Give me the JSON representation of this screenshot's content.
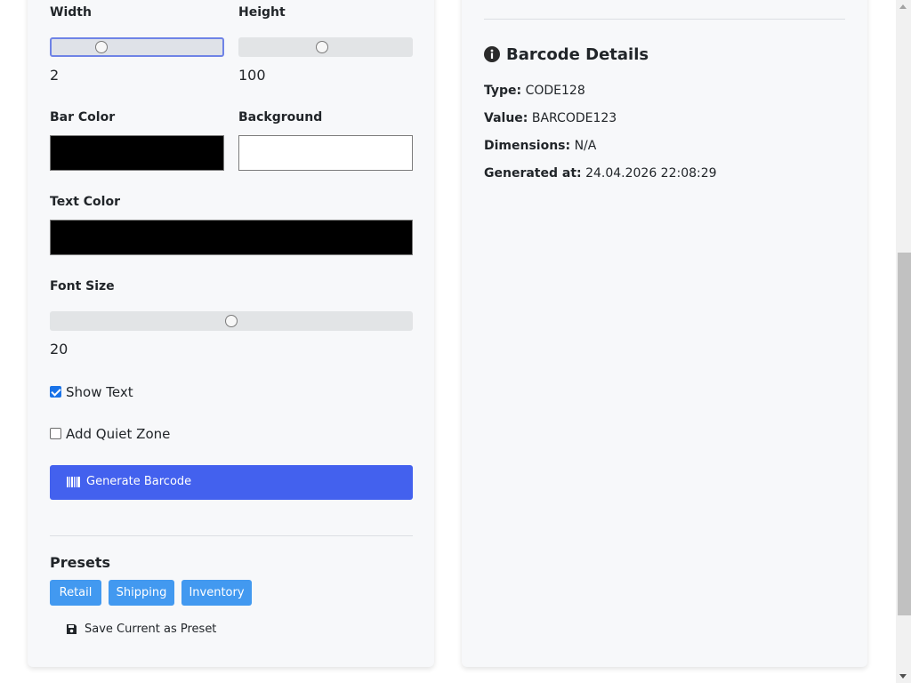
{
  "settings": {
    "width": {
      "label": "Width",
      "value": "2",
      "slider_fraction": 0.29
    },
    "height": {
      "label": "Height",
      "value": "100",
      "slider_fraction": 0.48
    },
    "bar_color": {
      "label": "Bar Color",
      "color": "#000000"
    },
    "background": {
      "label": "Background",
      "color": "#ffffff"
    },
    "text_color": {
      "label": "Text Color",
      "color": "#000000"
    },
    "font_size": {
      "label": "Font Size",
      "value": "20",
      "slider_fraction": 0.5
    },
    "show_text": {
      "label": "Show Text",
      "checked": true
    },
    "quiet_zone": {
      "label": "Add Quiet Zone",
      "checked": false
    },
    "generate_label": "Generate Barcode"
  },
  "presets": {
    "title": "Presets",
    "buttons": [
      "Retail",
      "Shipping",
      "Inventory"
    ],
    "save_label": "Save Current as Preset"
  },
  "details": {
    "title": "Barcode Details",
    "type_label": "Type:",
    "type_value": "CODE128",
    "value_label": "Value:",
    "value_value": "BARCODE123",
    "dimensions_label": "Dimensions:",
    "dimensions_value": "N/A",
    "generated_label": "Generated at:",
    "generated_value": "24.04.2026 22:08:29"
  },
  "colors": {
    "primary": "#4361ee",
    "preset": "#4299f0",
    "checkbox": "#1a73e8"
  },
  "icons": {
    "generate": "barcode-icon",
    "save": "floppy-disk-icon",
    "details": "info-circle-icon"
  }
}
